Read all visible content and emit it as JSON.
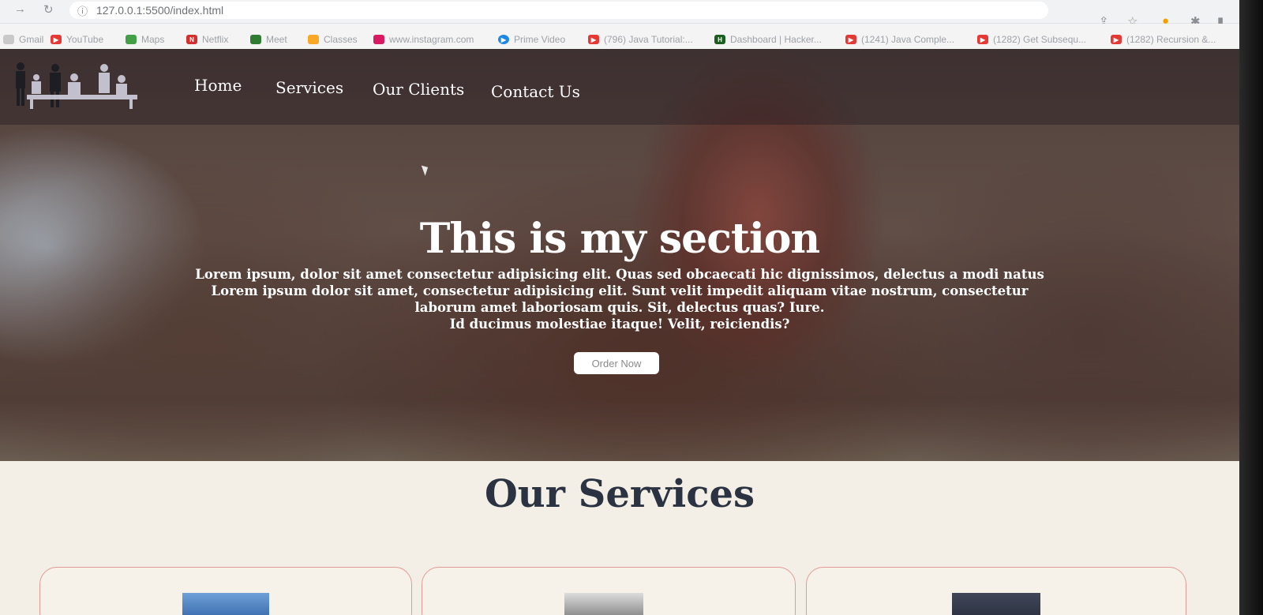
{
  "browser": {
    "url": "127.0.0.1:5500/index.html",
    "bookmarks": [
      {
        "label": "Gmail",
        "icon": "gmail-icon",
        "color": "#c9c9c9"
      },
      {
        "label": "YouTube",
        "icon": "youtube-icon",
        "color": "#e53935"
      },
      {
        "label": "Maps",
        "icon": "maps-icon",
        "color": "#43a047"
      },
      {
        "label": "Netflix",
        "icon": "netflix-icon",
        "color": "#d32f2f"
      },
      {
        "label": "Meet",
        "icon": "meet-icon",
        "color": "#2e7d32"
      },
      {
        "label": "Classes",
        "icon": "classes-icon",
        "color": "#f9a825"
      },
      {
        "label": "www.instagram.com",
        "icon": "instagram-icon",
        "color": "#d81b60"
      },
      {
        "label": "Prime Video",
        "icon": "prime-video-icon",
        "color": "#1e88e5"
      },
      {
        "label": "(796) Java Tutorial:...",
        "icon": "youtube-icon",
        "color": "#e53935"
      },
      {
        "label": "Dashboard | Hacker...",
        "icon": "hackerrank-icon",
        "color": "#1b5e20"
      },
      {
        "label": "(1241) Java Comple...",
        "icon": "youtube-icon",
        "color": "#e53935"
      },
      {
        "label": "(1282) Get Subsequ...",
        "icon": "youtube-icon",
        "color": "#e53935"
      },
      {
        "label": "(1282) Recursion &...",
        "icon": "youtube-icon",
        "color": "#e53935"
      }
    ]
  },
  "nav": {
    "links": [
      "Home",
      "Services",
      "Our Clients",
      "Contact Us"
    ]
  },
  "hero": {
    "title": "This is my section",
    "lines": [
      "Lorem ipsum, dolor sit amet consectetur adipisicing elit. Quas sed obcaecati hic dignissimos, delectus a modi natus",
      "Lorem ipsum dolor sit amet, consectetur adipisicing elit. Sunt velit impedit aliquam vitae nostrum, consectetur",
      "laborum amet laboriosam quis. Sit, delectus quas? Iure.",
      "Id ducimus molestiae itaque! Velit, reiciendis?"
    ],
    "button": "Order Now"
  },
  "services": {
    "title": "Our Services"
  },
  "colors": {
    "services_title": "#2b3342",
    "card_border": "#e29a95",
    "page_bg": "#f3efe6"
  }
}
